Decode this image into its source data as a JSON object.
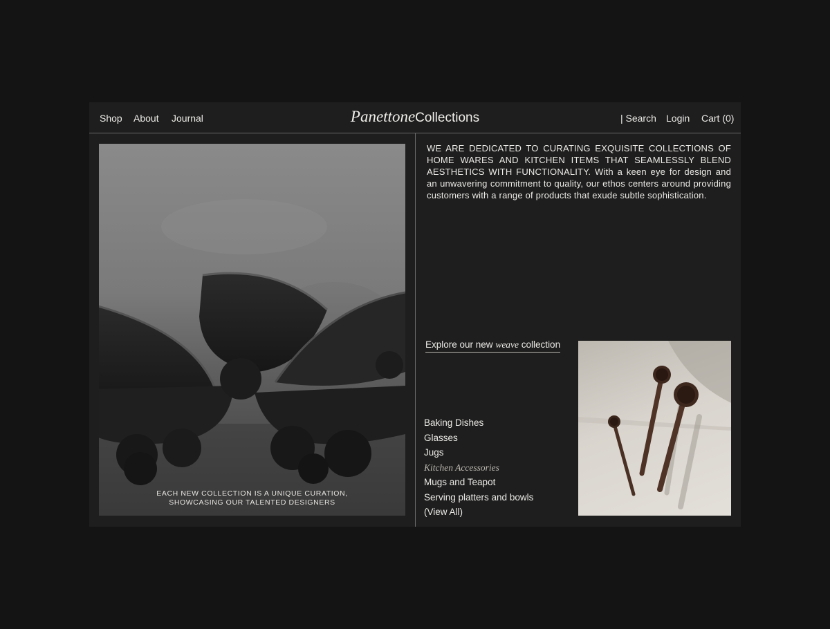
{
  "nav": {
    "left_links": [
      "Shop",
      "About",
      "Journal"
    ],
    "brand_script": "Panettone",
    "brand_text": "Collections",
    "search_label": "| Search",
    "login_label": "Login",
    "cart_label": "Cart (0)"
  },
  "hero": {
    "caption_line1": "EACH NEW COLLECTION IS A UNIQUE CURATION,",
    "caption_line2": "SHOWCASING OUR TALENTED DESIGNERS"
  },
  "intro": {
    "text_caps": "WE ARE DEDICATED TO CURATING EXQUISITE COLLECTIONS OF HOME WARES AND KITCHEN ITEMS THAT SEAMLESSLY BLEND AESTHETICS WITH FUNCTIONALITY.",
    "text_body": "With a keen eye for design and an unwavering commitment to quality, our ethos centers around providing customers with a range of products that exude subtle sophistication."
  },
  "explore": {
    "before": "Explore our new ",
    "italic": "weave",
    "after": " collection"
  },
  "categories": [
    "Baking Dishes",
    "Glasses",
    "Jugs",
    "Kitchen Accessories",
    "Mugs and Teapot",
    "Serving platters and bowls",
    "(View All)"
  ],
  "colors": {
    "page_bg": "#141414",
    "panel_bg": "#1e1e1e",
    "text": "#ecebe7",
    "divider": "#6a6a6a"
  }
}
